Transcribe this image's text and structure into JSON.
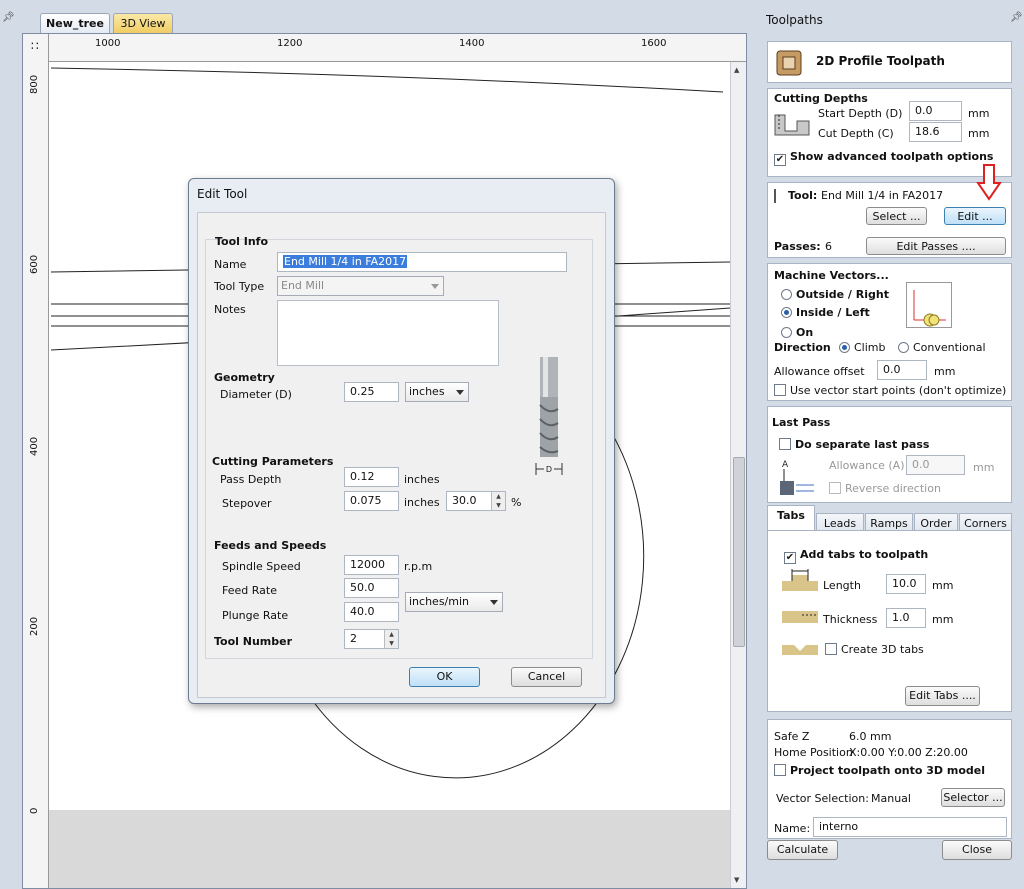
{
  "tabs": {
    "main": "New_tree",
    "view3d": "3D View"
  },
  "ruler": {
    "h": [
      "1000",
      "1200",
      "1400",
      "1600"
    ],
    "v": [
      "800",
      "600",
      "400",
      "200",
      "0"
    ]
  },
  "panel": {
    "title": "Toolpaths",
    "header": "2D Profile Toolpath",
    "depths": {
      "heading": "Cutting Depths",
      "start_label": "Start Depth (D)",
      "start_value": "0.0",
      "cut_label": "Cut Depth (C)",
      "cut_value": "18.6",
      "unit": "mm",
      "advanced": "Show advanced toolpath options"
    },
    "tool": {
      "label": "Tool:",
      "value": "End Mill 1/4 in FA2017",
      "select": "Select ...",
      "edit": "Edit ...",
      "passes_label": "Passes:",
      "passes_value": "6",
      "edit_passes": "Edit Passes ...."
    },
    "machine": {
      "heading": "Machine Vectors...",
      "outside": "Outside / Right",
      "inside": "Inside / Left",
      "on": "On",
      "direction": "Direction",
      "climb": "Climb",
      "conventional": "Conventional",
      "allowance_label": "Allowance offset",
      "allowance_value": "0.0",
      "unit": "mm",
      "use_start": "Use vector start points (don't optimize)"
    },
    "lastpass": {
      "heading": "Last Pass",
      "separate": "Do separate last pass",
      "allowance_label": "Allowance (A)",
      "allowance_value": "0.0",
      "unit": "mm",
      "reverse": "Reverse direction"
    },
    "ptabs": [
      "Tabs",
      "Leads",
      "Ramps",
      "Order",
      "Corners"
    ],
    "tabsec": {
      "add": "Add tabs to toolpath",
      "length_label": "Length",
      "length_value": "10.0",
      "thickness_label": "Thickness",
      "thickness_value": "1.0",
      "unit": "mm",
      "create3d": "Create 3D tabs",
      "edit_tabs": "Edit Tabs ...."
    },
    "safe": {
      "safez_label": "Safe Z",
      "safez_value": "6.0 mm",
      "home_label": "Home Position",
      "home_value": "X:0.00 Y:0.00 Z:20.00",
      "project": "Project toolpath onto 3D model",
      "vsel_label": "Vector Selection:",
      "vsel_value": "Manual",
      "selector": "Selector ...",
      "name_label": "Name:",
      "name_value": "interno"
    },
    "calculate": "Calculate",
    "close": "Close"
  },
  "dialog": {
    "title": "Edit Tool",
    "info": {
      "heading": "Tool Info",
      "name_label": "Name",
      "name_value": "End Mill 1/4 in FA2017",
      "type_label": "Tool Type",
      "type_value": "End Mill",
      "notes_label": "Notes"
    },
    "geometry": {
      "heading": "Geometry",
      "diameter_label": "Diameter (D)",
      "diameter_value": "0.25",
      "units": "inches",
      "diagram_label": "D"
    },
    "cutting": {
      "heading": "Cutting Parameters",
      "pass_label": "Pass Depth",
      "pass_value": "0.12",
      "pass_unit": "inches",
      "step_label": "Stepover",
      "step_value": "0.075",
      "step_unit": "inches",
      "step_pct": "30.0",
      "pct": "%"
    },
    "feeds": {
      "heading": "Feeds and Speeds",
      "spindle_label": "Spindle Speed",
      "spindle_value": "12000",
      "spindle_unit": "r.p.m",
      "feed_label": "Feed Rate",
      "feed_value": "50.0",
      "plunge_label": "Plunge Rate",
      "plunge_value": "40.0",
      "rate_unit": "inches/min"
    },
    "toolnum": {
      "label": "Tool Number",
      "value": "2"
    },
    "ok": "OK",
    "cancel": "Cancel"
  }
}
